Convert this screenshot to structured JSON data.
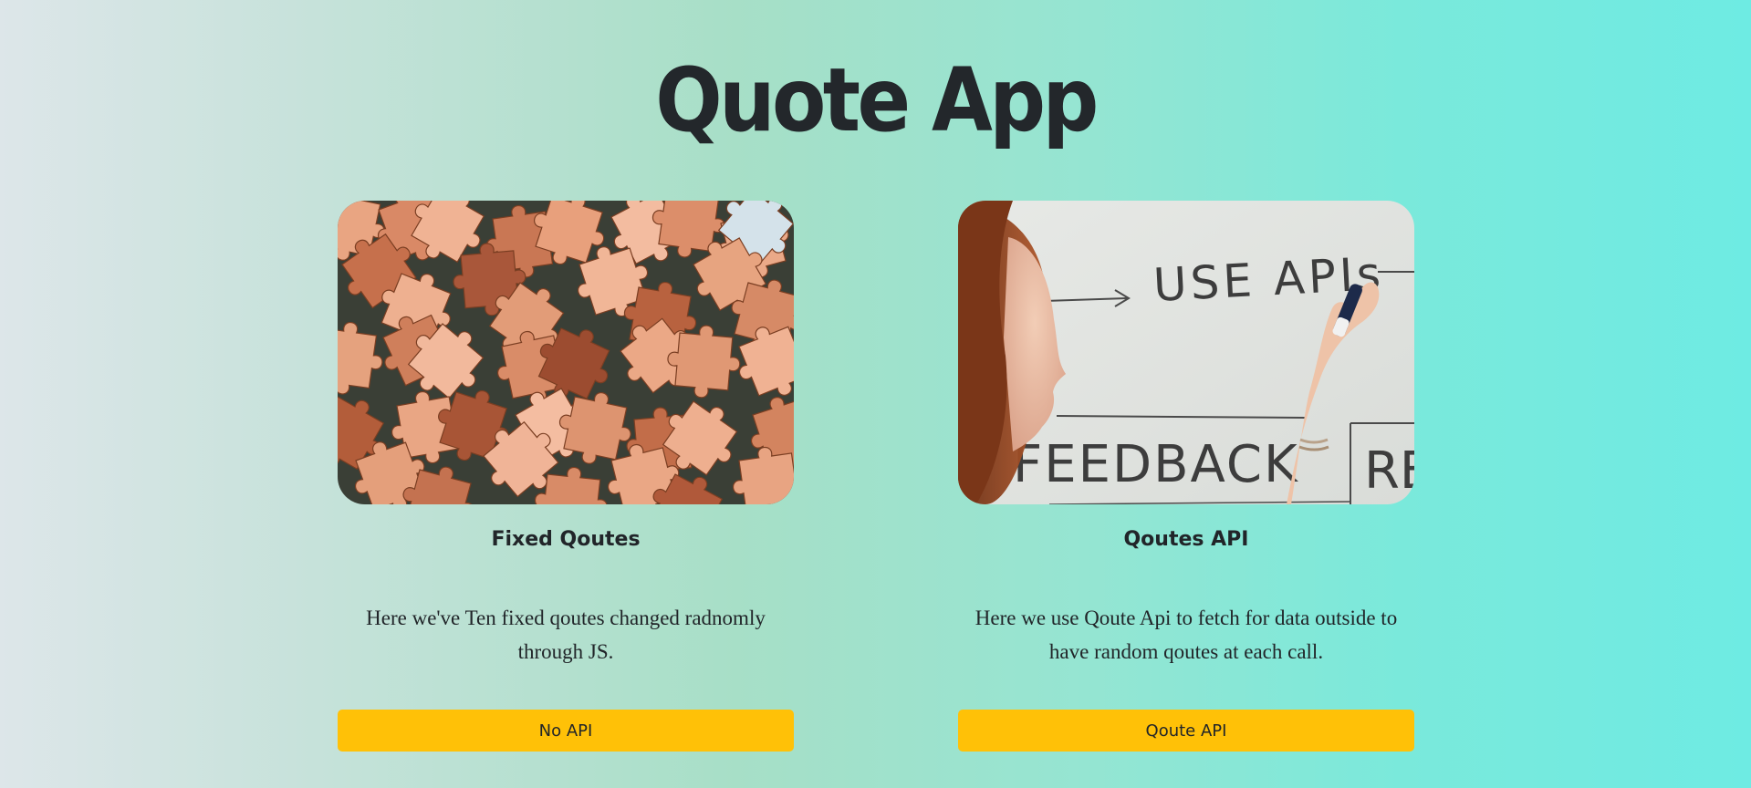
{
  "page": {
    "title": "Quote App"
  },
  "cards": [
    {
      "image": "jigsaw-puzzle-pieces-photo",
      "title": "Fixed Qoutes",
      "text": "Here we've Ten fixed qoutes changed radnomly through JS.",
      "button": "No API"
    },
    {
      "image": "woman-writing-whiteboard-photo",
      "title": "Qoutes API",
      "text": "Here we use Qoute Api to fetch for data outside to have random qoutes at each call.",
      "button": "Qoute API",
      "whiteboard": {
        "top_text": "USE APIs",
        "bottom_text": "FEEDBACK",
        "corner_text": "RE"
      }
    }
  ],
  "colors": {
    "button": "#ffc107",
    "text": "#212529",
    "background_start": "#dde6e9",
    "background_end": "#6eebe3"
  }
}
